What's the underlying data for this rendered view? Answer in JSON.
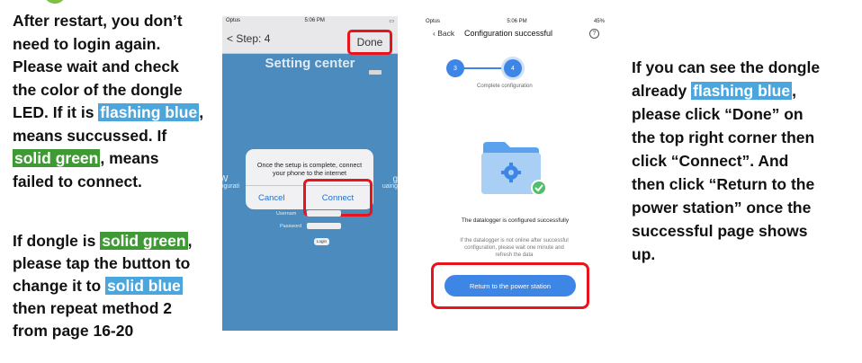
{
  "note_left_top": {
    "line1": "After restart, you don’t",
    "line2": "need to login again.",
    "line3": "Please wait and check",
    "line4": "the color of the dongle",
    "line5_pre": "LED. If it is ",
    "line5_hl": "flashing blue",
    "line5_post": ",",
    "line6": "means succussed. If",
    "line7_hl": "solid green",
    "line7_post": ", means",
    "line8": "failed to connect."
  },
  "note_left_bottom": {
    "line1_pre": "If dongle is ",
    "line1_hl": "solid green",
    "line1_post": ",",
    "line2": "please tap the button to",
    "line3_pre": "change it to ",
    "line3_hl": "solid blue",
    "line4": "then repeat method 2",
    "line5": "from page 16-20"
  },
  "note_right": {
    "line1": "If you can see the dongle",
    "line2_pre": "already ",
    "line2_hl": "flashing blue",
    "line2_post": ",",
    "line3": "please click “Done” on",
    "line4": "the top right corner then",
    "line5": "click “Connect”. And",
    "line6": "then click “Return to the",
    "line7": "power station” once the",
    "line8": "successful page shows",
    "line9": "up."
  },
  "phone1": {
    "status_carrier": "Optus",
    "status_time": "5:06 PM",
    "back_label": "< Step: 4",
    "done_label": "Done",
    "title": "Setting center",
    "side_left": "W",
    "side_right": "g",
    "side_left_small": "figurati",
    "side_right_small": "uaing",
    "alert_message": "Once the setup is complete, connect your phone to the internet",
    "alert_cancel": "Cancel",
    "alert_connect": "Connect",
    "username_label": "Usernam",
    "password_label": "Password",
    "login_label": "Login",
    "colors": {
      "background": "#4b8bbd",
      "highlight": "#e8141b"
    }
  },
  "phone2": {
    "status_carrier": "Optus",
    "status_time": "5:06 PM",
    "status_battery": "45%",
    "back_label": "Back",
    "page_title": "Configuration successful",
    "help_icon": "?",
    "step3": "3",
    "step4": "4",
    "step_label": "Complete configuration",
    "icon": "folder-gear-check-icon",
    "success_message": "The datalogger is configured successfully",
    "hint_message": "If the datalogger is not online after successful configuration, please wait one minute and refresh the data",
    "return_button": "Return to the power station",
    "colors": {
      "accent": "#3e86e6",
      "highlight": "#e8141b"
    }
  }
}
